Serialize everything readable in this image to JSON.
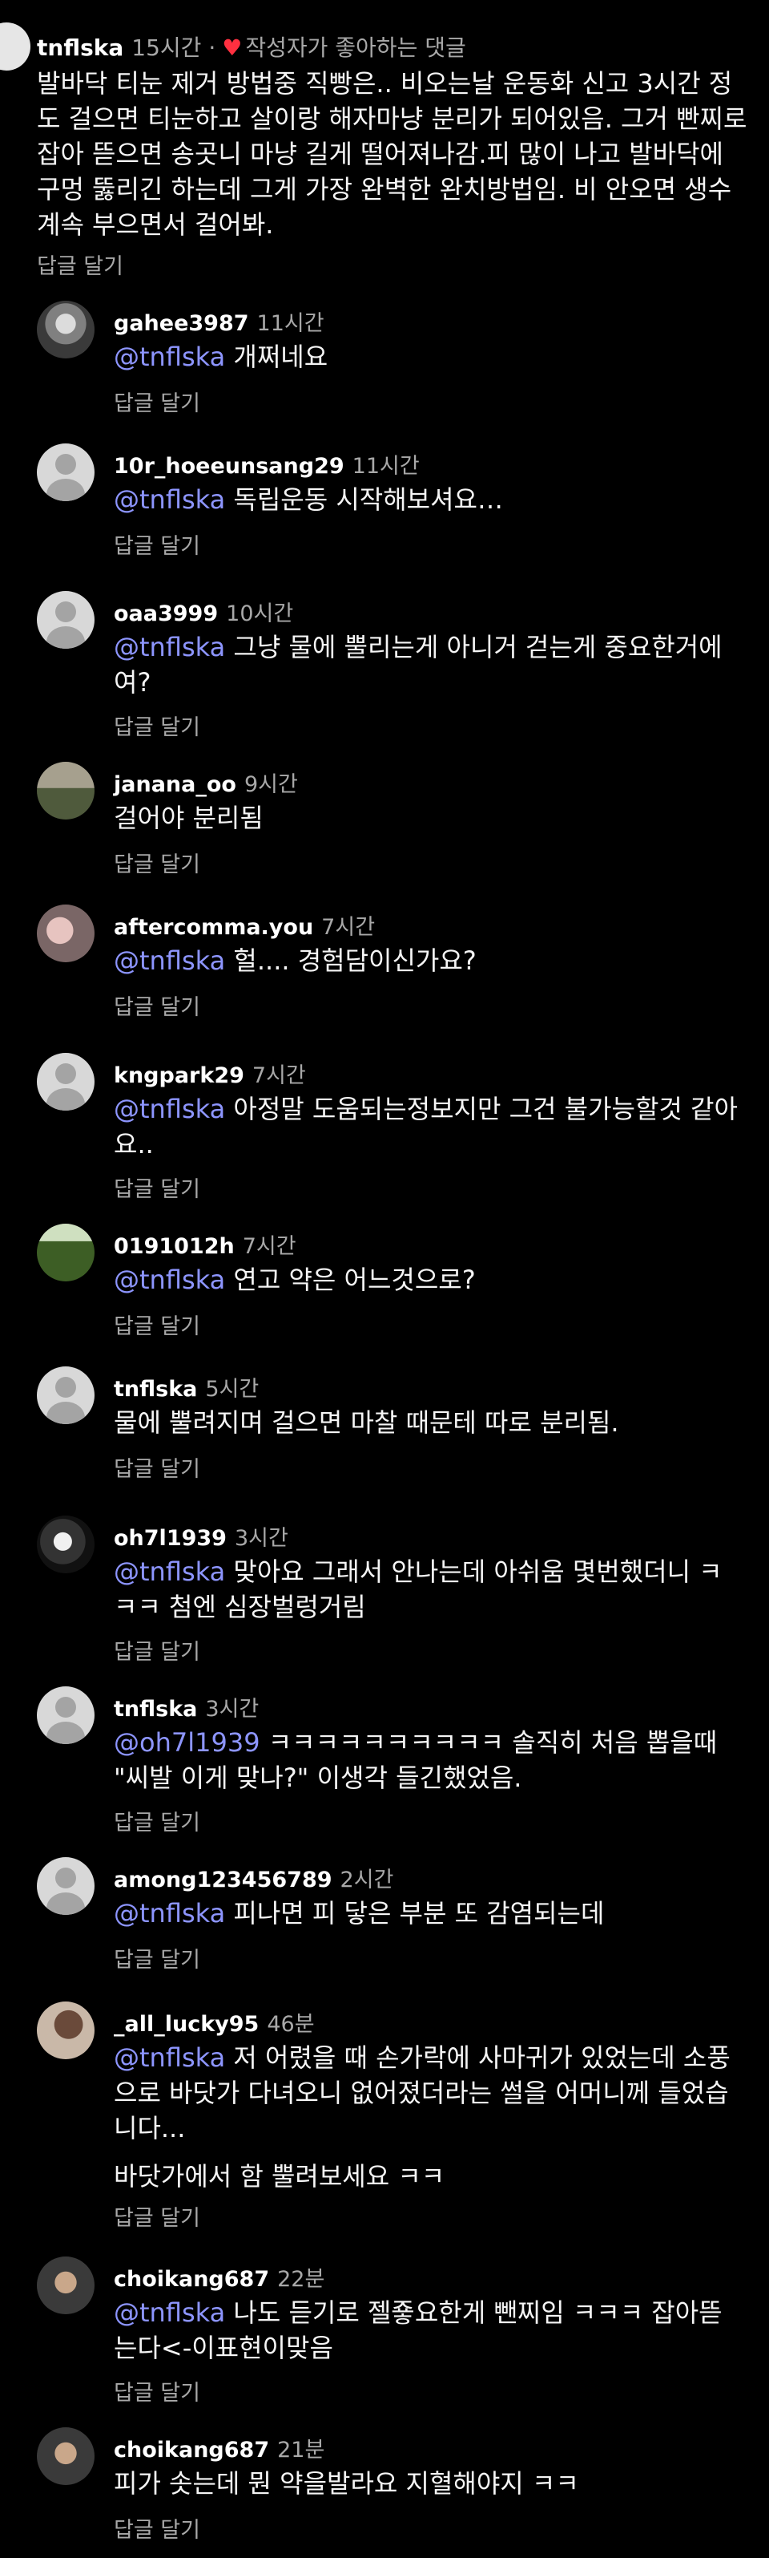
{
  "top_comment": {
    "username": "tnflska",
    "time": "15시간",
    "dot": "·",
    "liked_label": "작성자가 좋아하는 댓글",
    "body": "발바닥 티눈 제거 방법중 직빵은.. 비오는날 운동화 신고 3시간 정도 걸으면 티눈하고 살이랑 해자마냥 분리가 되어있음. 그거 빤찌로 잡아 뜯으면 송곳니 마냥 길게 떨어져나감.피 많이 나고 발바닥에 구멍 뚫리긴 하는데  그게 가장 완벽한 완치방법임. 비 안오면 생수 계속 부으면서 걸어봐.",
    "reply_label": "답글 달기"
  },
  "replies": [
    {
      "username": "gahee3987",
      "time": "11시간",
      "mention": "@tnflska",
      "text": " 개쩌네요",
      "reply_label": "답글 달기"
    },
    {
      "username": "10r_hoeeunsang29",
      "time": "11시간",
      "mention": "@tnflska",
      "text": " 독립운동 시작해보셔요…",
      "reply_label": "답글 달기"
    },
    {
      "username": "oaa3999",
      "time": "10시간",
      "mention": "@tnflska",
      "text": " 그냥 물에 뿔리는게 아니거 걷는게 중요한거에여?",
      "reply_label": "답글 달기"
    },
    {
      "username": "janana_oo",
      "time": "9시간",
      "mention": "",
      "text": "걸어야 분리됨",
      "reply_label": "답글 달기"
    },
    {
      "username": "aftercomma.you",
      "time": "7시간",
      "mention": "@tnflska",
      "text": " 헐.... 경험담이신가요?",
      "reply_label": "답글 달기"
    },
    {
      "username": "kngpark29",
      "time": "7시간",
      "mention": "@tnflska",
      "text": " 아정말 도움되는정보지만 그건 불가능할것 같아요..",
      "reply_label": "답글 달기"
    },
    {
      "username": "0191012h",
      "time": "7시간",
      "mention": "@tnflska",
      "text": " 연고 약은 어느것으로?",
      "reply_label": "답글 달기"
    },
    {
      "username": "tnflska",
      "time": "5시간",
      "mention": "",
      "text": "물에 뿔려지며 걸으면 마찰 때문테 따로 분리됨.",
      "reply_label": "답글 달기"
    },
    {
      "username": "oh7l1939",
      "time": "3시간",
      "mention": "@tnflska",
      "text": " 맞아요 그래서 안나는데 아쉬움 몇번했더니 ㅋㅋㅋ 첨엔 심장벌렁거림",
      "reply_label": "답글 달기"
    },
    {
      "username": "tnflska",
      "time": "3시간",
      "mention": "@oh7l1939",
      "text": " ㅋㅋㅋㅋㅋㅋㅋㅋㅋㅋ  솔직히 처음 뽑을때 \"씨발 이게 맞나?\" 이생각 들긴했었음.",
      "reply_label": "답글 달기"
    },
    {
      "username": "among123456789",
      "time": "2시간",
      "mention": "@tnflska",
      "text": " 피나면 피 닿은 부분 또 감염되는데",
      "reply_label": "답글 달기"
    },
    {
      "username": "_all_lucky95",
      "time": "46분",
      "mention": "@tnflska",
      "text": " 저 어렸을 때 손가락에 사마귀가 있었는데 소풍으로 바닷가 다녀오니 없어졌더라는 썰을 어머니께 들었습니다...",
      "text2": "바닷가에서 함 뿔려보세요 ㅋㅋ",
      "reply_label": "답글 달기"
    },
    {
      "username": "choikang687",
      "time": "22분",
      "mention": "@tnflska",
      "text": " 나도 듣기로 젤죻요한게 뺀찌임 ㅋㅋㅋ 잡아뜯는다<-이표현이맞음",
      "reply_label": "답글 달기"
    },
    {
      "username": "choikang687",
      "time": "21분",
      "mention": "",
      "text": "피가 솟는데 뭔 약을발라요 지혈해야지 ㅋㅋ",
      "reply_label": "답글 달기"
    }
  ]
}
